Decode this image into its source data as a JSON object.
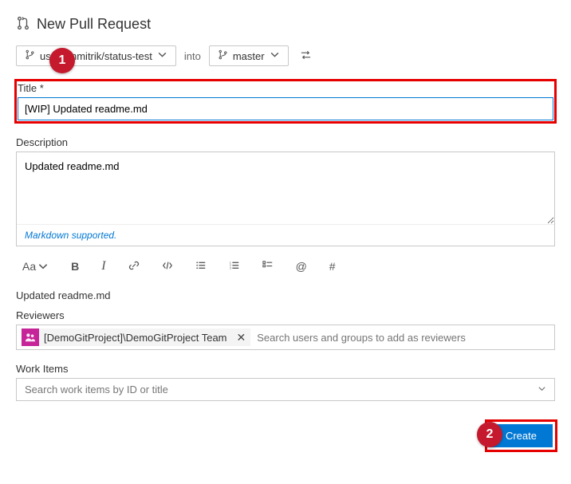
{
  "header": {
    "title": "New Pull Request"
  },
  "branches": {
    "source": "users/mmitrik/status-test",
    "into": "into",
    "target": "master"
  },
  "title": {
    "label": "Title *",
    "value": "[WIP] Updated readme.md"
  },
  "description": {
    "label": "Description",
    "value": "Updated readme.md",
    "hint": "Markdown supported."
  },
  "toolbar": {
    "text_size": "Aa",
    "bold": "B",
    "italic": "I",
    "at": "@",
    "hash": "#"
  },
  "preview": "Updated readme.md",
  "reviewers": {
    "label": "Reviewers",
    "chip": "[DemoGitProject]\\DemoGitProject Team",
    "placeholder": "Search users and groups to add as reviewers"
  },
  "workitems": {
    "label": "Work Items",
    "placeholder": "Search work items by ID or title"
  },
  "actions": {
    "create": "Create"
  },
  "callouts": {
    "one": "1",
    "two": "2"
  }
}
